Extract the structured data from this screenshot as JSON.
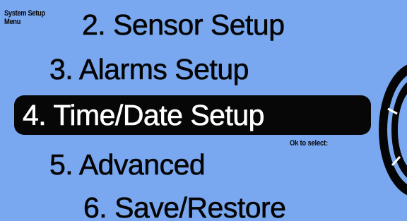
{
  "title": {
    "line1": "System Setup",
    "line2": "Menu"
  },
  "menu": {
    "items": [
      {
        "label": "2. Sensor Setup"
      },
      {
        "label": "3. Alarms Setup"
      },
      {
        "label": "4. Time/Date Setup",
        "selected": true
      },
      {
        "label": "5. Advanced"
      },
      {
        "label": "6. Save/Restore"
      }
    ]
  },
  "hint": "Ok to select:",
  "dial": {
    "icon": "rotary-knob-icon"
  },
  "colors": {
    "background": "#7aa8f0",
    "selection": "#070707",
    "text": "#050505",
    "selected_text": "#ffffff"
  }
}
